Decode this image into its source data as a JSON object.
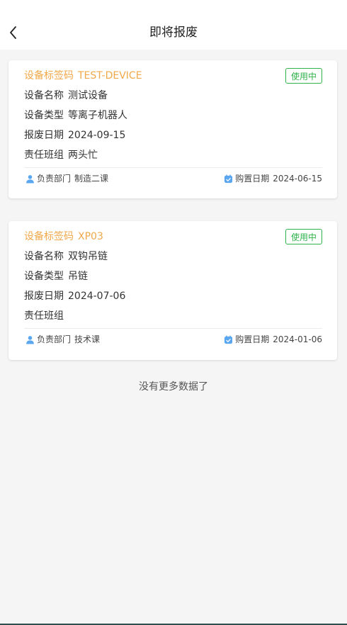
{
  "header": {
    "title": "即将报废",
    "back_icon": "chevron-left-icon"
  },
  "colors": {
    "accent_orange": "#f0a84a",
    "status_green": "#2fb34a",
    "icon_blue": "#5aa7f0"
  },
  "devices": [
    {
      "code_label": "设备标签码",
      "code": "TEST-DEVICE",
      "status": "使用中",
      "name_label": "设备名称",
      "name": "测试设备",
      "type_label": "设备类型",
      "type": "等离子机器人",
      "scrap_label": "报废日期",
      "scrap_date": "2024-09-15",
      "team_label": "责任班组",
      "team": "两头忙",
      "dept_label": "负责部门",
      "dept": "制造二课",
      "purchase_label": "购置日期",
      "purchase_date": "2024-06-15"
    },
    {
      "code_label": "设备标签码",
      "code": "XP03",
      "status": "使用中",
      "name_label": "设备名称",
      "name": "双钩吊链",
      "type_label": "设备类型",
      "type": "吊链",
      "scrap_label": "报废日期",
      "scrap_date": "2024-07-06",
      "team_label": "责任班组",
      "team": "",
      "dept_label": "负责部门",
      "dept": "技术课",
      "purchase_label": "购置日期",
      "purchase_date": "2024-01-06"
    }
  ],
  "footer_text": "没有更多数据了"
}
